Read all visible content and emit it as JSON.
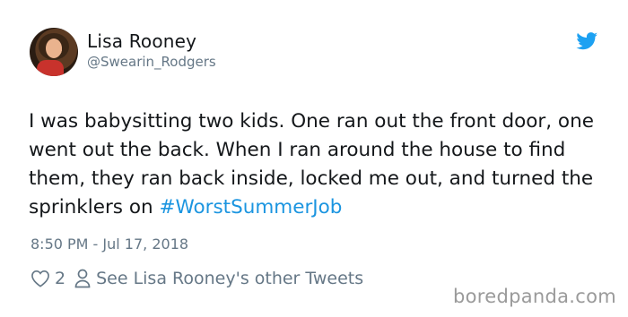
{
  "user": {
    "name": "Lisa Rooney",
    "handle": "@Swearin_Rodgers"
  },
  "tweet": {
    "text_before": "I was babysitting two kids. One ran out the front door, one went out the back. When I ran around the house to find them, they ran back inside, locked me out, and turned the sprinklers on ",
    "hashtag": "#WorstSummerJob",
    "timestamp": "8:50 PM - Jul 17, 2018"
  },
  "actions": {
    "like_count": "2",
    "profile_link": "See Lisa Rooney's other Tweets"
  },
  "watermark": "boredpanda.com",
  "icons": {
    "twitter": "twitter-bird-icon",
    "like": "heart-icon",
    "profile": "person-icon"
  },
  "colors": {
    "accent": "#1b95e0",
    "secondary_text": "#657786",
    "primary_text": "#14171a"
  }
}
